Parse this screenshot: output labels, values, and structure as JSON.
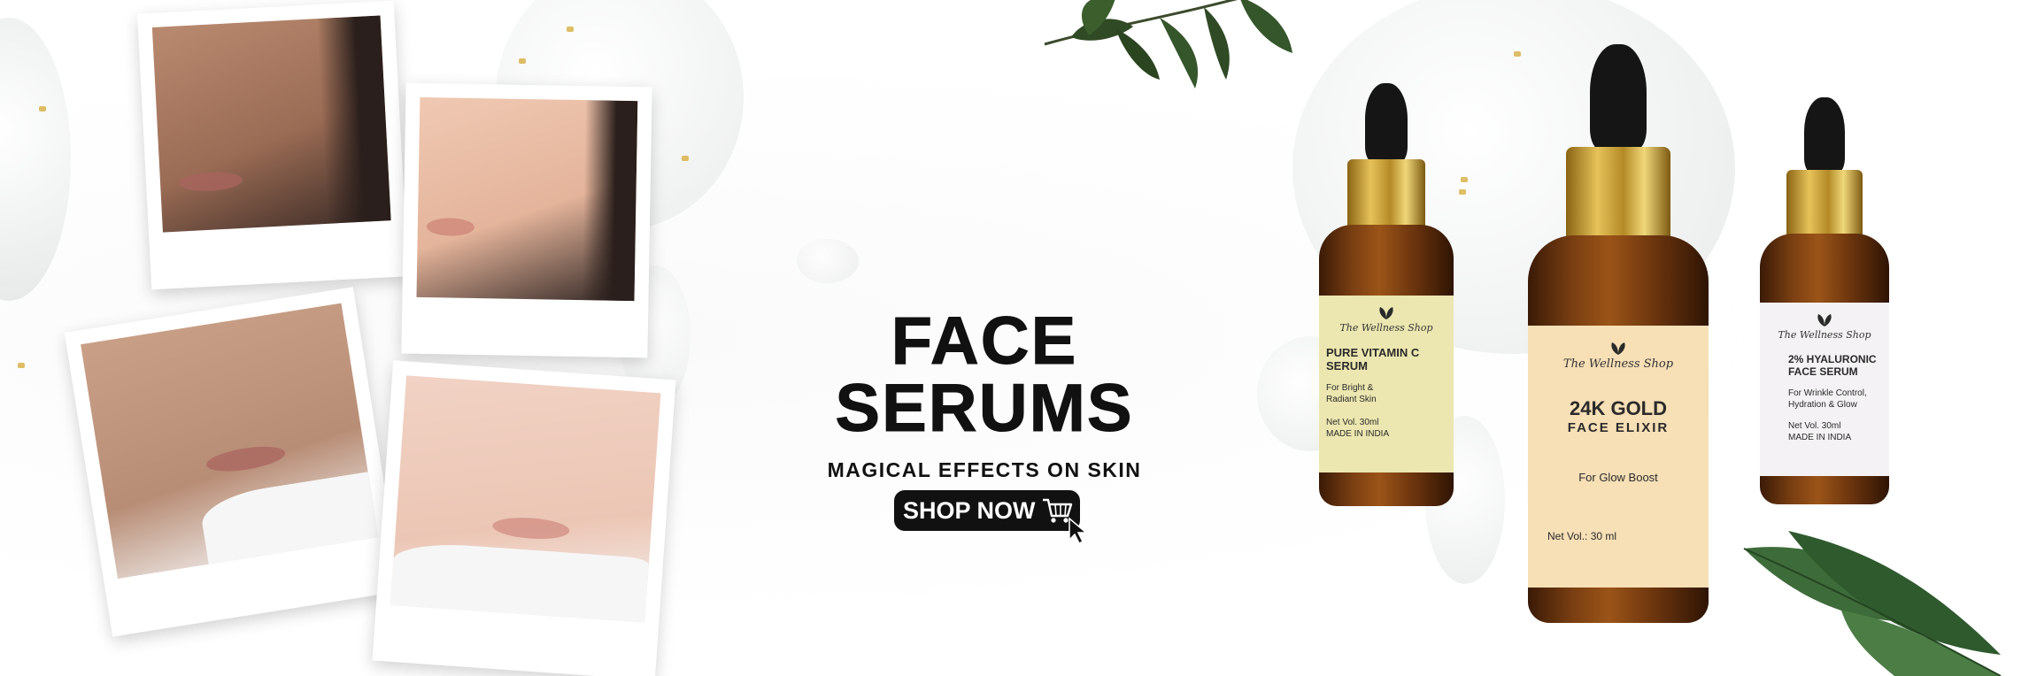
{
  "headline": {
    "title": "FACE SERUMS",
    "subtitle": "MAGICAL EFFECTS ON SKIN"
  },
  "cta": {
    "label": "SHOP NOW",
    "icon": "shopping-cart-icon"
  },
  "products": [
    {
      "brand": "The Wellness Shop",
      "name_line1": "PURE VITAMIN C",
      "name_line2": "SERUM",
      "benefit": "For Bright & Radiant Skin",
      "volume": "Net Vol. 30ml",
      "origin": "MADE IN INDIA",
      "label_color": "#ece7b0"
    },
    {
      "brand": "The Wellness Shop",
      "name_line1": "24K GOLD",
      "name_line2": "FACE ELIXIR",
      "benefit": "For Glow Boost",
      "volume": "Net Vol.: 30 ml",
      "label_color": "#f7dfb6"
    },
    {
      "brand": "The Wellness Shop",
      "name_line1": "2% HYALURONIC",
      "name_line2": "FACE SERUM",
      "benefit": "For Wrinkle Control, Hydration & Glow",
      "volume": "Net Vol. 30ml",
      "origin": "MADE IN INDIA",
      "label_color": "#f4f2f4"
    }
  ],
  "colors": {
    "text": "#111111",
    "button": "#111111",
    "gold": "#d8b24a",
    "amber_glass": "#7a3f12"
  }
}
